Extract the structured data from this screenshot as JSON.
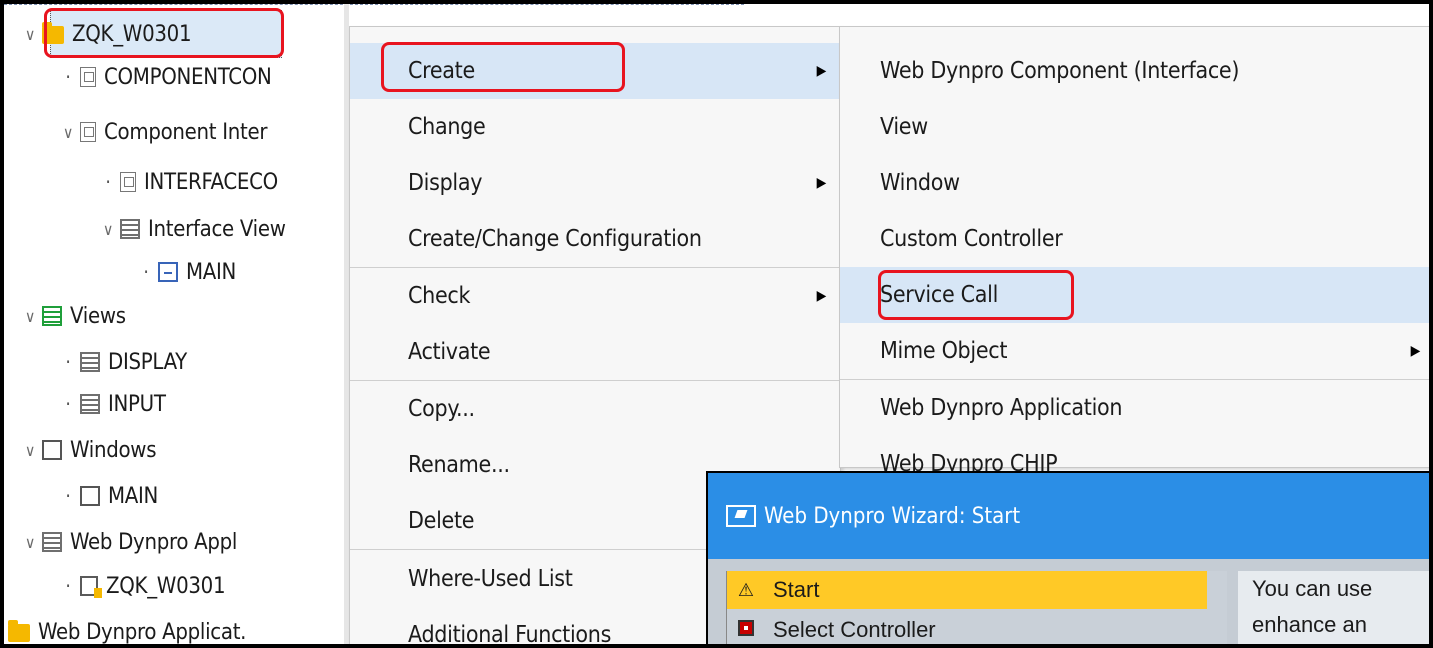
{
  "tree": {
    "root": "ZQK_W0301",
    "items": [
      {
        "label": "COMPONENTCON",
        "icon": "component-controller-icon"
      },
      {
        "label": "Component Inter",
        "icon": "component-interface-icon"
      },
      {
        "label": "INTERFACECO",
        "icon": "interface-controller-icon"
      },
      {
        "label": "Interface View",
        "icon": "interface-view-icon"
      },
      {
        "label": "MAIN",
        "icon": "window-icon"
      },
      {
        "label": "Views",
        "icon": "views-folder-icon"
      },
      {
        "label": "DISPLAY",
        "icon": "view-icon"
      },
      {
        "label": "INPUT",
        "icon": "view-icon"
      },
      {
        "label": "Windows",
        "icon": "windows-folder-icon"
      },
      {
        "label": "MAIN",
        "icon": "window-icon"
      },
      {
        "label": "Web Dynpro Appl",
        "icon": "applications-folder-icon"
      },
      {
        "label": "ZQK_W0301",
        "icon": "application-icon"
      },
      {
        "label": "Web Dynpro Applicat.",
        "icon": "folder-icon"
      }
    ]
  },
  "context_menu": {
    "items": [
      {
        "label": "Create",
        "submenu": true
      },
      {
        "label": "Change",
        "submenu": false
      },
      {
        "label": "Display",
        "submenu": true
      },
      {
        "label": "Create/Change Configuration",
        "submenu": false
      },
      {
        "label": "Check",
        "submenu": true
      },
      {
        "label": "Activate",
        "submenu": false
      },
      {
        "label": "Copy...",
        "submenu": false
      },
      {
        "label": "Rename...",
        "submenu": false
      },
      {
        "label": "Delete",
        "submenu": false
      },
      {
        "label": "Where-Used List",
        "submenu": false
      },
      {
        "label": "Additional Functions",
        "submenu": false
      }
    ]
  },
  "create_submenu": {
    "items": [
      {
        "label": "Web Dynpro Component (Interface)",
        "submenu": false
      },
      {
        "label": "View",
        "submenu": false
      },
      {
        "label": "Window",
        "submenu": false
      },
      {
        "label": "Custom Controller",
        "submenu": false
      },
      {
        "label": "Service Call",
        "submenu": false
      },
      {
        "label": "Mime Object",
        "submenu": true
      },
      {
        "label": "Web Dynpro Application",
        "submenu": false
      },
      {
        "label": "Web Dynpro CHIP",
        "submenu": false
      }
    ]
  },
  "wizard": {
    "title": "Web Dynpro Wizard: Start",
    "steps": [
      {
        "label": "Start",
        "icon": "warning-triangle-icon"
      },
      {
        "label": "Select Controller",
        "icon": "red-square-icon"
      }
    ],
    "text_line1": "You can use",
    "text_line2": "enhance an"
  },
  "colors": {
    "highlight": "#d7e6f6",
    "annotation_red": "#e8141f",
    "wizard_title": "#2b8ee6",
    "active_step": "#ffc926",
    "folder": "#f5b800"
  }
}
